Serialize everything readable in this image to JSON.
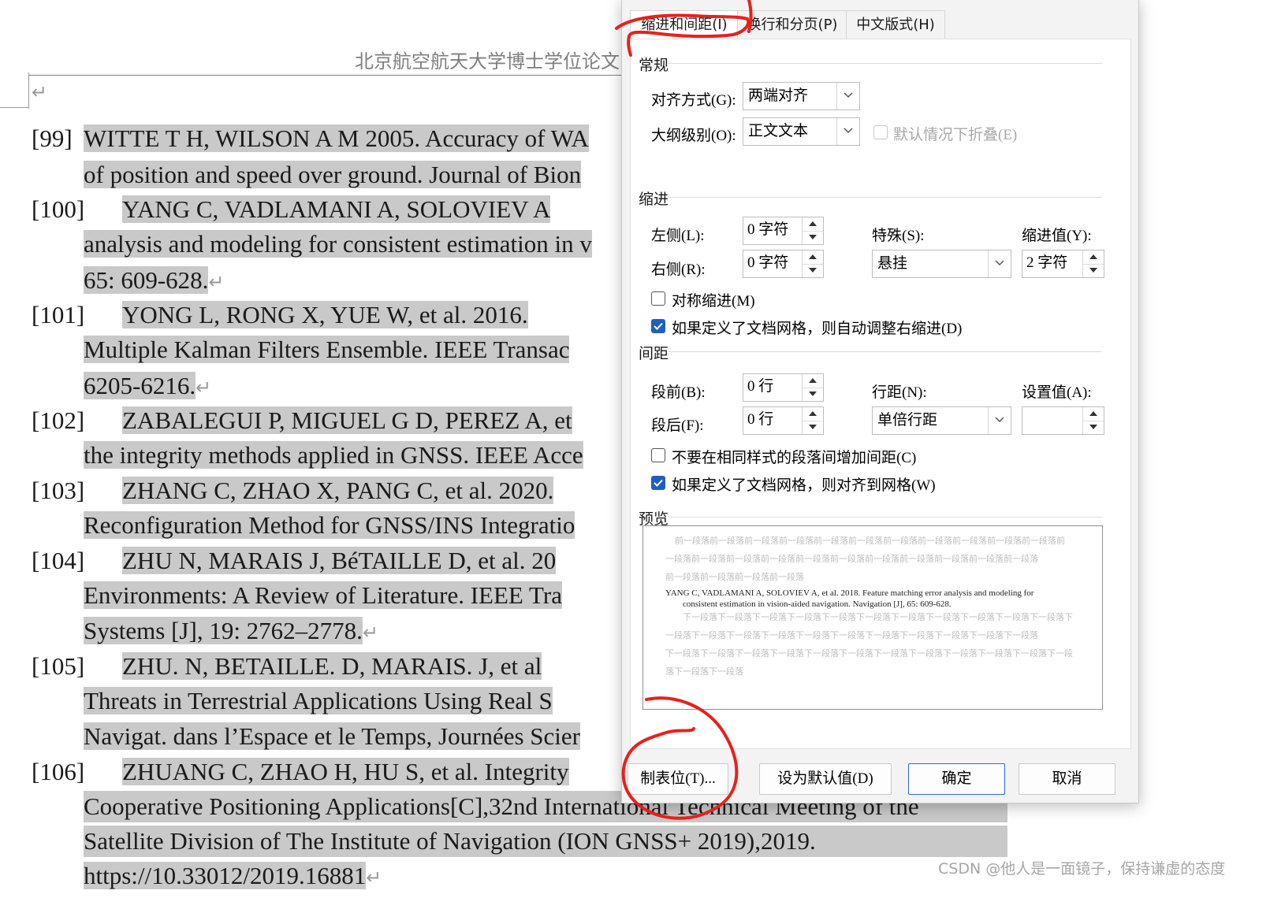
{
  "document": {
    "header_title": "北京航空航天大学博士学位论文",
    "para_mark": "↵",
    "refs": [
      {
        "num": "[99]",
        "lines": [
          "WITTE T H, WILSON A M 2005. Accuracy of WA",
          "of position and speed over ground. Journal of Bion"
        ]
      },
      {
        "num": "[100]",
        "lines": [
          "YANG  C,  VADLAMANI  A,  SOLOVIEV  A",
          "analysis and modeling for consistent estimation in v",
          "65: 609-628."
        ]
      },
      {
        "num": "[101]",
        "lines": [
          "YONG  L,  RONG  X,  YUE  W,  et  al.  2016.",
          "Multiple Kalman Filters Ensemble. IEEE Transac",
          "6205-6216."
        ]
      },
      {
        "num": "[102]",
        "lines": [
          "ZABALEGUI P, MIGUEL G D, PEREZ A, et",
          "the integrity methods applied in GNSS. IEEE Acce"
        ]
      },
      {
        "num": "[103]",
        "lines": [
          "ZHANG  C,  ZHAO  X,  PANG  C,  et  al.  2020.",
          "Reconfiguration Method for GNSS/INS Integratio"
        ]
      },
      {
        "num": "[104]",
        "lines": [
          "ZHU  N,  MARAIS  J,  BéTAILLE  D,  et  al.  20",
          "Environments: A Review of Literature. IEEE Tra",
          "Systems [J], 19: 2762–2778."
        ]
      },
      {
        "num": "[105]",
        "lines": [
          "ZHU.  N,  BETAILLE.  D,  MARAIS.  J,  et  al",
          "Threats  in  Terrestrial  Applications  Using  Real  S",
          "Navigat. dans l’Espace et le Temps, Journées Scier"
        ]
      },
      {
        "num": "[106]",
        "lines": [
          "ZHUANG C, ZHAO H, HU S, et al. Integrity",
          "Cooperative Positioning Applications[C],32nd International Technical Meeting of the",
          "Satellite Division of The Institute of Navigation (ION GNSS+ 2019),2019.",
          "https://10.33012/2019.16881"
        ]
      }
    ]
  },
  "dialog": {
    "tabs": [
      {
        "label": "缩进和间距(I)",
        "active": true
      },
      {
        "label": "换行和分页(P)",
        "active": false
      },
      {
        "label": "中文版式(H)",
        "active": false
      }
    ],
    "general": {
      "section": "常规",
      "alignment_label": "对齐方式(G):",
      "alignment_value": "两端对齐",
      "outline_label": "大纲级别(O):",
      "outline_value": "正文文本",
      "collapse_label": "默认情况下折叠(E)"
    },
    "indent": {
      "section": "缩进",
      "left_label": "左侧(L):",
      "left_value": "0 字符",
      "right_label": "右侧(R):",
      "right_value": "0 字符",
      "special_label": "特殊(S):",
      "special_value": "悬挂",
      "by_label": "缩进值(Y):",
      "by_value": "2 字符",
      "mirror_label": "对称缩进(M)",
      "auto_adjust_label": "如果定义了文档网格，则自动调整右缩进(D)"
    },
    "spacing": {
      "section": "间距",
      "before_label": "段前(B):",
      "before_value": "0 行",
      "after_label": "段后(F):",
      "after_value": "0 行",
      "line_label": "行距(N):",
      "line_value": "单倍行距",
      "at_label": "设置值(A):",
      "at_value": "",
      "no_space_label": "不要在相同样式的段落间增加间距(C)",
      "snap_label": "如果定义了文档网格，则对齐到网格(W)"
    },
    "preview": {
      "section": "预览",
      "before_lines": [
        "前一段落前一段落前一段落前一段落前一段落前一段落前一段落前一段落前一段落前一段落前一段落前",
        "一段落前一段落前一段落前一段落前一段落前一段落前一段落前一段落前一段落前一段落前一段落",
        "前一段落前一段落前一段落前一段落"
      ],
      "main_lines": [
        "YANG C, VADLAMANI A, SOLOVIEV A, et al. 2018. Feature matching error analysis and modeling for",
        "consistent estimation in vision-aided navigation. Navigation [J], 65: 609-628."
      ],
      "after_lines": [
        "下一段落下一段落下一段落下一段落下一段落下一段落下一段落下一段落下一段落下一段落下一段落下",
        "一段落下一段落下一段落下一段落下一段落下一段落下一段落下一段落下一段落下一段落下一段落",
        "下一段落下一段落下一段落下一段落下一段落下一段落下一段落下一段落下一段落下一段落下一段落下一段",
        "落下一段落下一段落"
      ]
    },
    "buttons": {
      "tabs": "制表位(T)...",
      "set_default": "设为默认值(D)",
      "ok": "确定",
      "cancel": "取消"
    }
  },
  "watermark": "CSDN @他人是一面镜子，保持谦虚的态度",
  "colors": {
    "highlight": "#c9c9c9",
    "accent": "#1f5fbf",
    "annotation": "#e8201c"
  }
}
